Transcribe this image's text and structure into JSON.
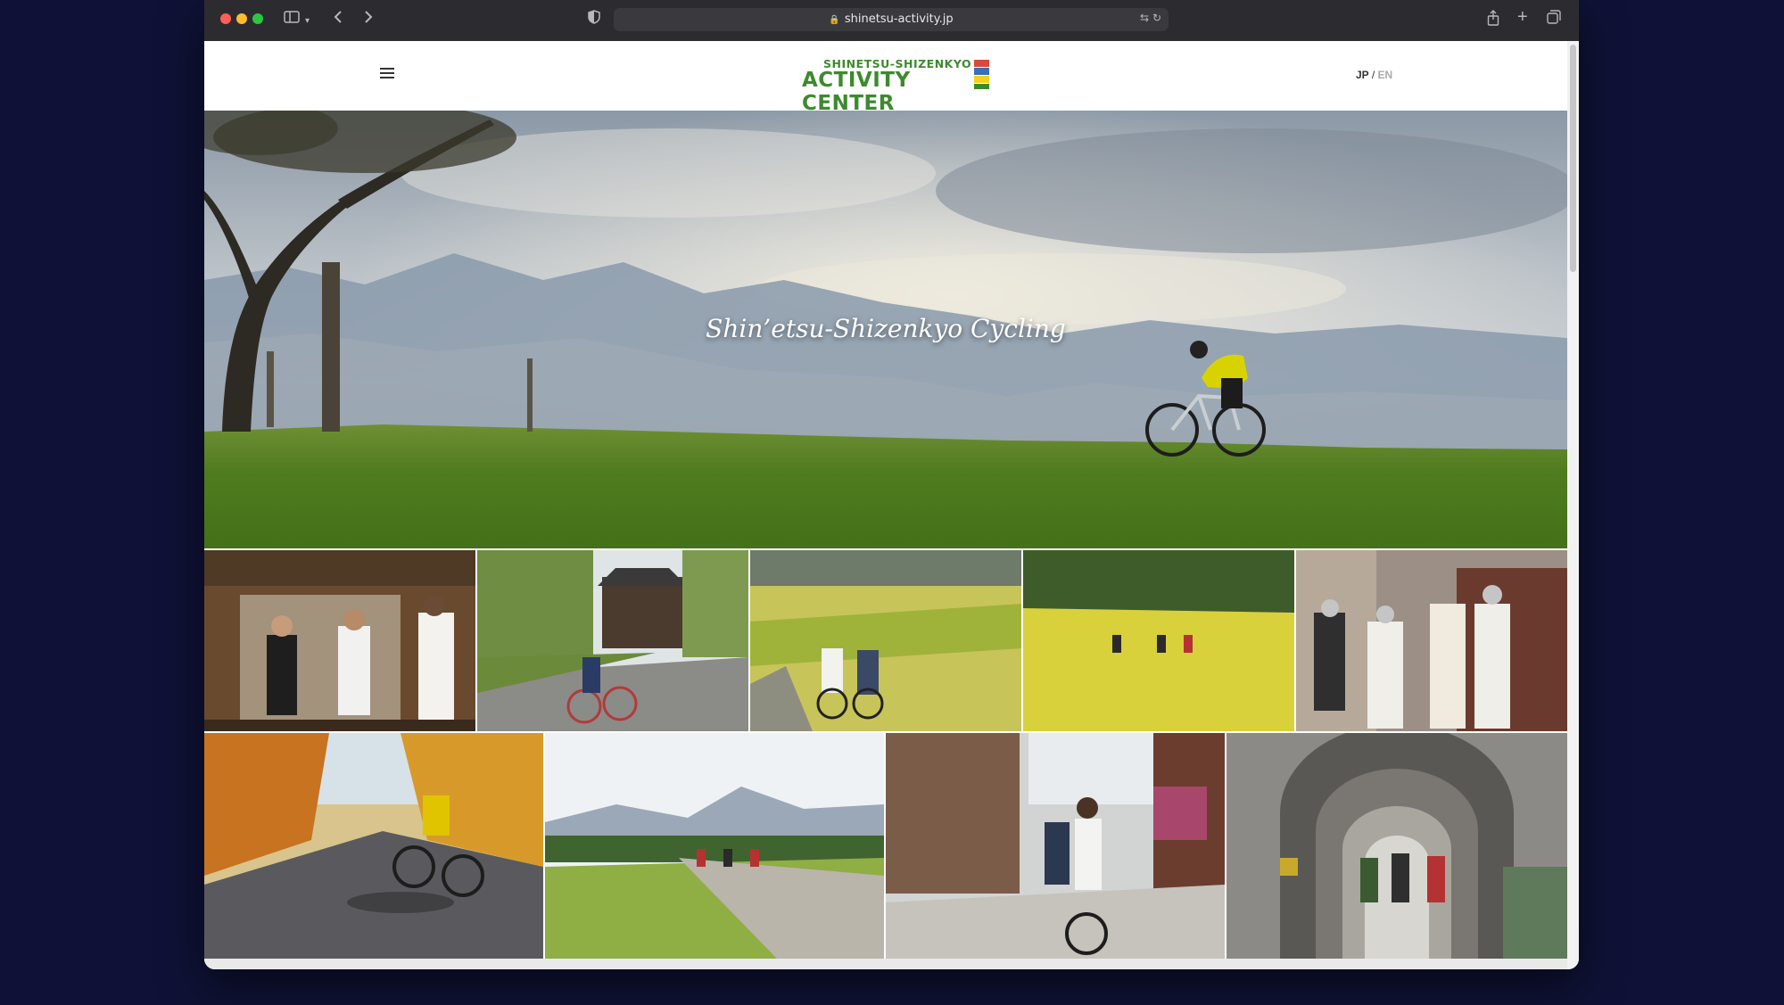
{
  "browser": {
    "url": "shinetsu-activity.jp"
  },
  "header": {
    "logo_top": "SHINETSU-SHIZENKYO",
    "logo_main": "ACTIVITY CENTER",
    "lang_jp": "JP",
    "lang_sep": "/",
    "lang_en": "EN"
  },
  "hero": {
    "title": "Shin’etsu-Shizenkyo Cycling"
  },
  "colors": {
    "brand_green": "#3d8a2e",
    "flag": [
      "#d84a3c",
      "#3b6fb6",
      "#f2d21b",
      "#3d8a2e"
    ]
  }
}
